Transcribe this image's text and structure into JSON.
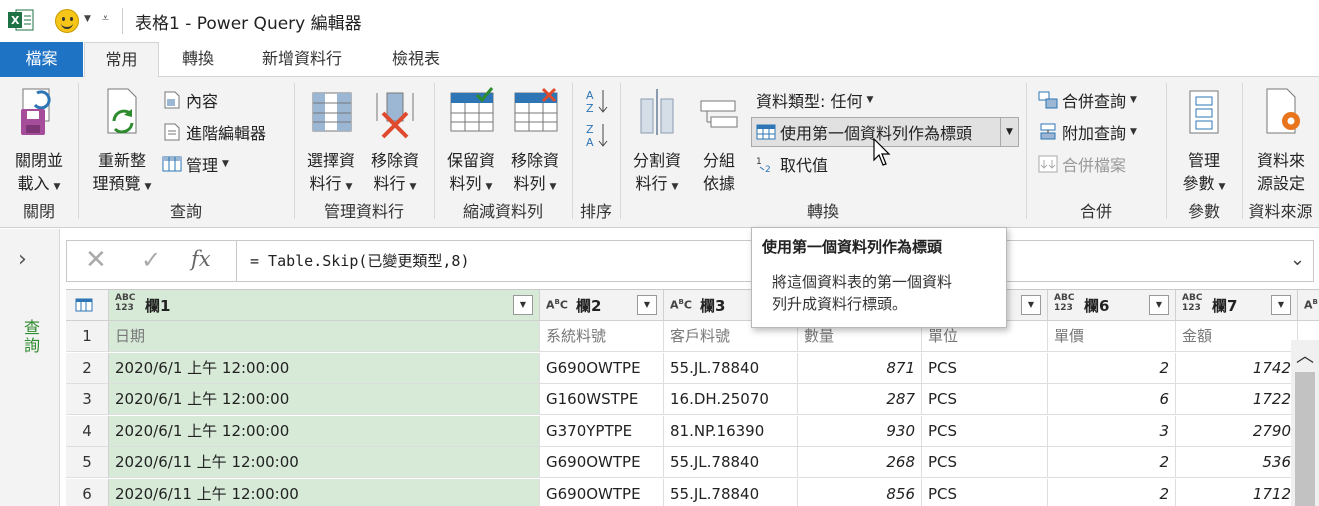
{
  "window": {
    "title": "表格1 - Power Query 編輯器"
  },
  "tabs": [
    {
      "label": "檔案"
    },
    {
      "label": "常用"
    },
    {
      "label": "轉換"
    },
    {
      "label": "新增資料行"
    },
    {
      "label": "檢視表"
    }
  ],
  "ribbon": {
    "close": {
      "line1": "關閉並",
      "line2": "載入",
      "group": "關閉"
    },
    "query": {
      "refresh_line1": "重新整",
      "refresh_line2": "理預覽",
      "properties": "內容",
      "advanced_editor": "進階編輯器",
      "manage": "管理",
      "group": "查詢"
    },
    "manage_columns": {
      "choose_line1": "選擇資",
      "choose_line2": "料行",
      "remove_line1": "移除資",
      "remove_line2": "料行",
      "group": "管理資料行"
    },
    "reduce_rows": {
      "keep_line1": "保留資",
      "keep_line2": "料列",
      "remove_line1": "移除資",
      "remove_line2": "料列",
      "group": "縮減資料列"
    },
    "sort": {
      "group": "排序"
    },
    "transform": {
      "split_line1": "分割資",
      "split_line2": "料行",
      "groupby_line1": "分組",
      "groupby_line2": "依據",
      "data_type": "資料類型: 任何",
      "use_first_row": "使用第一個資料列作為標頭",
      "replace_values": "取代值",
      "group": "轉換"
    },
    "combine": {
      "merge": "合併查詢",
      "append": "附加查詢",
      "combine_files": "合併檔案",
      "group": "合併"
    },
    "params": {
      "line1": "管理",
      "line2": "參數",
      "group": "參數"
    },
    "datasource": {
      "line1": "資料來",
      "line2": "源設定",
      "group": "資料來源"
    }
  },
  "left_panel": {
    "label": "查詢"
  },
  "formula_bar": {
    "formula": "= Table.Skip(已變更類型,8)"
  },
  "tooltip": {
    "title": "使用第一個資料列作為標頭",
    "body_line1": "將這個資料表的第一個資料",
    "body_line2": "列升成資料行標頭。"
  },
  "grid": {
    "columns": [
      {
        "type": "ABC\n123",
        "name": "欄1"
      },
      {
        "type": "ABC",
        "name": "欄2"
      },
      {
        "type": "ABC",
        "name": "欄3"
      },
      {
        "type": "ABC\n123",
        "name": "欄6"
      },
      {
        "type": "ABC\n123",
        "name": "欄7"
      }
    ],
    "rows": [
      {
        "n": "1",
        "c1": "日期",
        "c2": "系統料號",
        "c3": "客戶料號",
        "c4": "數量",
        "c5": "單位",
        "c6": "單價",
        "c7": "金額"
      },
      {
        "n": "2",
        "c1": "2020/6/1 上午 12:00:00",
        "c2": "G690OWTPE",
        "c3": "55.JL.78840",
        "c4": "871",
        "c5": "PCS",
        "c6": "2",
        "c7": "1742"
      },
      {
        "n": "3",
        "c1": "2020/6/1 上午 12:00:00",
        "c2": "G160WSTPE",
        "c3": "16.DH.25070",
        "c4": "287",
        "c5": "PCS",
        "c6": "6",
        "c7": "1722"
      },
      {
        "n": "4",
        "c1": "2020/6/1 上午 12:00:00",
        "c2": "G370YPTPE",
        "c3": "81.NP.16390",
        "c4": "930",
        "c5": "PCS",
        "c6": "3",
        "c7": "2790"
      },
      {
        "n": "5",
        "c1": "2020/6/11 上午 12:00:00",
        "c2": "G690OWTPE",
        "c3": "55.JL.78840",
        "c4": "268",
        "c5": "PCS",
        "c6": "2",
        "c7": "536"
      },
      {
        "n": "6",
        "c1": "2020/6/11 上午 12:00:00",
        "c2": "G690OWTPE",
        "c3": "55.JL.78840",
        "c4": "856",
        "c5": "PCS",
        "c6": "2",
        "c7": "1712"
      }
    ]
  }
}
